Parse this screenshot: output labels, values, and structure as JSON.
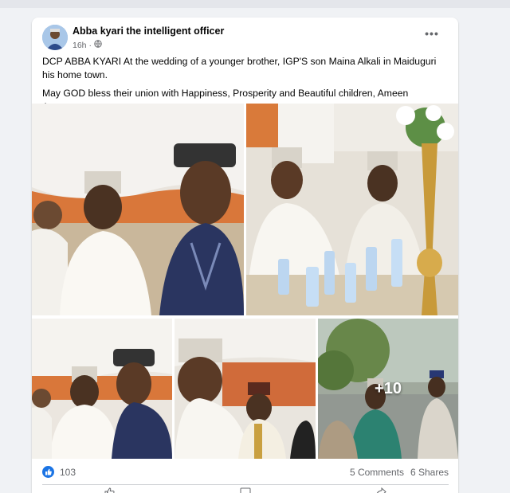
{
  "post": {
    "author": "Abba kyari the intelligent officer",
    "time": "16h",
    "privacy_icon": "globe-icon",
    "more_icon": "more-horizontal-icon",
    "paragraphs": [
      "DCP ABBA KYARI At the wedding of a younger brother, IGP'S son Maina Alkali in Maiduguri his home town.",
      "May GOD bless their union with Happiness, Prosperity and Beautiful children, Ameen Ameen."
    ],
    "more_photos_label": "+10"
  },
  "stats": {
    "reaction_icon": "like-icon",
    "likes": "103",
    "comments": "5 Comments",
    "shares": "6 Shares"
  },
  "colors": {
    "accent": "#1b74e4",
    "muted_text": "#65676b",
    "background": "#f0f2f5"
  }
}
